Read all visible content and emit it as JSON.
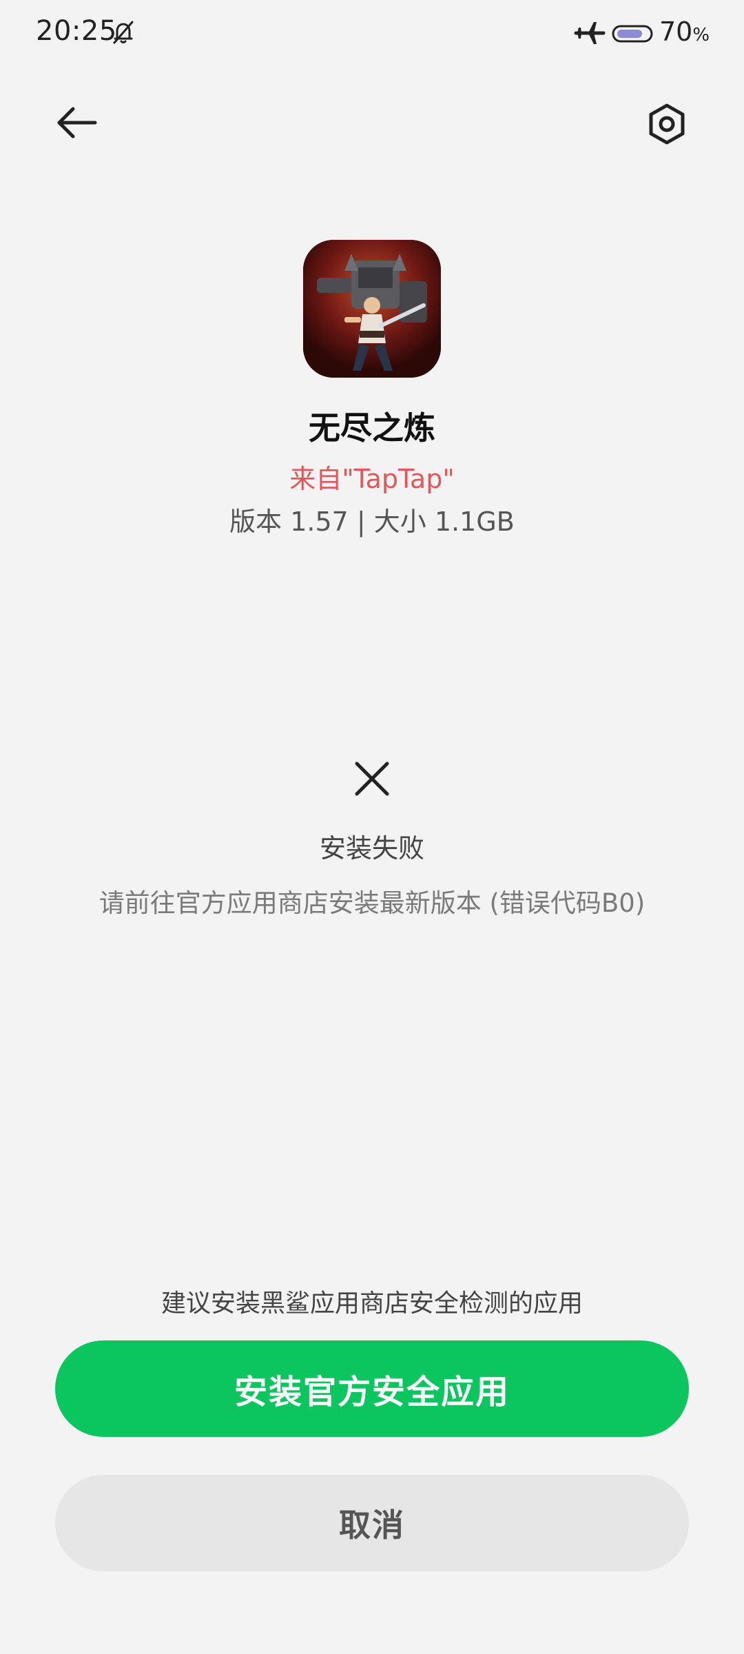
{
  "status_bar": {
    "time": "20:25",
    "battery_level": "70",
    "battery_unit": "%",
    "icons": [
      "bell-off-icon",
      "airplane-icon",
      "battery-icon"
    ]
  },
  "header": {
    "back_icon": "arrow-left-icon",
    "settings_icon": "settings-hex-icon"
  },
  "app": {
    "name": "无尽之炼",
    "source": "来自\"TapTap\"",
    "meta": "版本 1.57 | 大小 1.1GB"
  },
  "result": {
    "icon": "close-icon",
    "title": "安装失败",
    "description": "请前往官方应用商店安装最新版本 (错误代码B0)"
  },
  "footer": {
    "suggestion": "建议安装黑鲨应用商店安全检测的应用",
    "primary_label": "安装官方安全应用",
    "secondary_label": "取消"
  },
  "colors": {
    "primary_button": "#0bc65f",
    "source_text": "#e2585a",
    "background": "#f3f3f3"
  }
}
